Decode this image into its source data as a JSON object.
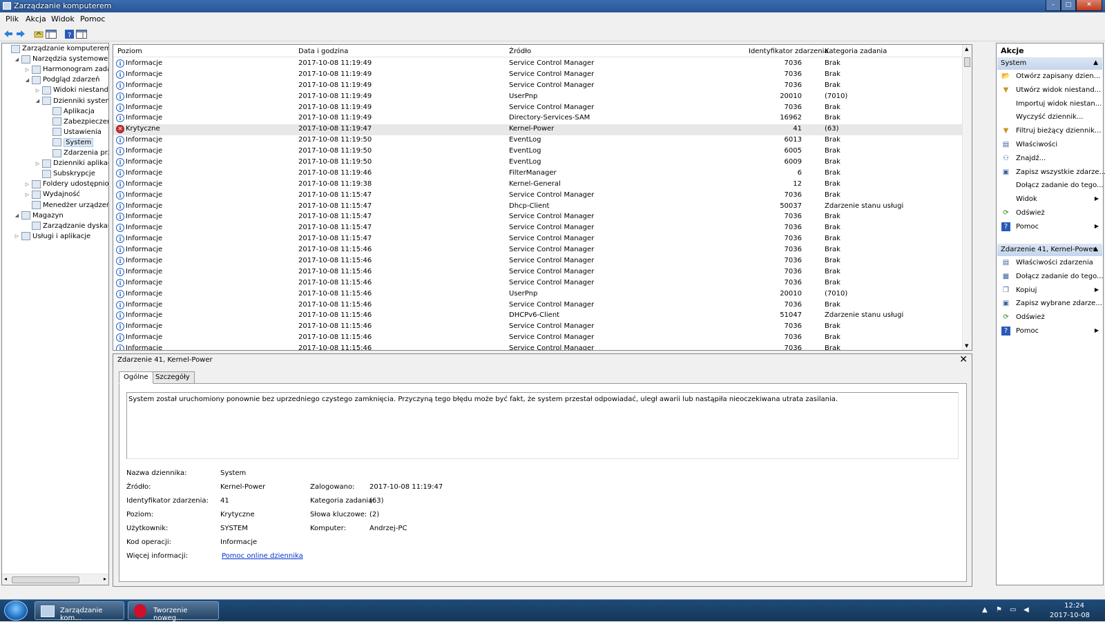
{
  "window": {
    "title": "Zarządzanie komputerem",
    "min": "–",
    "max": "□",
    "close": "✕"
  },
  "menu": [
    "Plik",
    "Akcja",
    "Widok",
    "Pomoc"
  ],
  "tree": [
    {
      "label": "Zarządzanie komputerem (loka",
      "depth": 0,
      "exp": ""
    },
    {
      "label": "Narzędzia systemowe",
      "depth": 1,
      "exp": "◢"
    },
    {
      "label": "Harmonogram zadań",
      "depth": 2,
      "exp": "▷"
    },
    {
      "label": "Podgląd zdarzeń",
      "depth": 2,
      "exp": "◢"
    },
    {
      "label": "Widoki niestandardo",
      "depth": 3,
      "exp": "▷"
    },
    {
      "label": "Dzienniki systemu W",
      "depth": 3,
      "exp": "◢"
    },
    {
      "label": "Aplikacja",
      "depth": 4,
      "exp": ""
    },
    {
      "label": "Zabezpieczenia",
      "depth": 4,
      "exp": ""
    },
    {
      "label": "Ustawienia",
      "depth": 4,
      "exp": ""
    },
    {
      "label": "System",
      "depth": 4,
      "exp": "",
      "selected": true
    },
    {
      "label": "Zdarzenia przesy",
      "depth": 4,
      "exp": ""
    },
    {
      "label": "Dzienniki aplikacji i u",
      "depth": 3,
      "exp": "▷"
    },
    {
      "label": "Subskrypcje",
      "depth": 3,
      "exp": ""
    },
    {
      "label": "Foldery udostępnione",
      "depth": 2,
      "exp": "▷"
    },
    {
      "label": "Wydajność",
      "depth": 2,
      "exp": "▷"
    },
    {
      "label": "Menedżer urządzeń",
      "depth": 2,
      "exp": ""
    },
    {
      "label": "Magazyn",
      "depth": 1,
      "exp": "◢"
    },
    {
      "label": "Zarządzanie dyskami",
      "depth": 2,
      "exp": ""
    },
    {
      "label": "Usługi i aplikacje",
      "depth": 1,
      "exp": "▷"
    }
  ],
  "grid": {
    "columns": [
      "Poziom",
      "Data i godzina",
      "Źródło",
      "Identyfikator zdarzenia",
      "Kategoria zadania"
    ],
    "rows": [
      {
        "level": "Informacje",
        "date": "2017-10-08 11:19:49",
        "source": "Service Control Manager",
        "id": "7036",
        "cat": "Brak"
      },
      {
        "level": "Informacje",
        "date": "2017-10-08 11:19:49",
        "source": "Service Control Manager",
        "id": "7036",
        "cat": "Brak"
      },
      {
        "level": "Informacje",
        "date": "2017-10-08 11:19:49",
        "source": "Service Control Manager",
        "id": "7036",
        "cat": "Brak"
      },
      {
        "level": "Informacje",
        "date": "2017-10-08 11:19:49",
        "source": "UserPnp",
        "id": "20010",
        "cat": "(7010)"
      },
      {
        "level": "Informacje",
        "date": "2017-10-08 11:19:49",
        "source": "Service Control Manager",
        "id": "7036",
        "cat": "Brak"
      },
      {
        "level": "Informacje",
        "date": "2017-10-08 11:19:49",
        "source": "Directory-Services-SAM",
        "id": "16962",
        "cat": "Brak"
      },
      {
        "level": "Krytyczne",
        "date": "2017-10-08 11:19:47",
        "source": "Kernel-Power",
        "id": "41",
        "cat": "(63)",
        "critical": true
      },
      {
        "level": "Informacje",
        "date": "2017-10-08 11:19:50",
        "source": "EventLog",
        "id": "6013",
        "cat": "Brak"
      },
      {
        "level": "Informacje",
        "date": "2017-10-08 11:19:50",
        "source": "EventLog",
        "id": "6005",
        "cat": "Brak"
      },
      {
        "level": "Informacje",
        "date": "2017-10-08 11:19:50",
        "source": "EventLog",
        "id": "6009",
        "cat": "Brak"
      },
      {
        "level": "Informacje",
        "date": "2017-10-08 11:19:46",
        "source": "FilterManager",
        "id": "6",
        "cat": "Brak"
      },
      {
        "level": "Informacje",
        "date": "2017-10-08 11:19:38",
        "source": "Kernel-General",
        "id": "12",
        "cat": "Brak"
      },
      {
        "level": "Informacje",
        "date": "2017-10-08 11:15:47",
        "source": "Service Control Manager",
        "id": "7036",
        "cat": "Brak"
      },
      {
        "level": "Informacje",
        "date": "2017-10-08 11:15:47",
        "source": "Dhcp-Client",
        "id": "50037",
        "cat": "Zdarzenie stanu usługi"
      },
      {
        "level": "Informacje",
        "date": "2017-10-08 11:15:47",
        "source": "Service Control Manager",
        "id": "7036",
        "cat": "Brak"
      },
      {
        "level": "Informacje",
        "date": "2017-10-08 11:15:47",
        "source": "Service Control Manager",
        "id": "7036",
        "cat": "Brak"
      },
      {
        "level": "Informacje",
        "date": "2017-10-08 11:15:47",
        "source": "Service Control Manager",
        "id": "7036",
        "cat": "Brak"
      },
      {
        "level": "Informacje",
        "date": "2017-10-08 11:15:46",
        "source": "Service Control Manager",
        "id": "7036",
        "cat": "Brak"
      },
      {
        "level": "Informacje",
        "date": "2017-10-08 11:15:46",
        "source": "Service Control Manager",
        "id": "7036",
        "cat": "Brak"
      },
      {
        "level": "Informacje",
        "date": "2017-10-08 11:15:46",
        "source": "Service Control Manager",
        "id": "7036",
        "cat": "Brak"
      },
      {
        "level": "Informacje",
        "date": "2017-10-08 11:15:46",
        "source": "Service Control Manager",
        "id": "7036",
        "cat": "Brak"
      },
      {
        "level": "Informacje",
        "date": "2017-10-08 11:15:46",
        "source": "UserPnp",
        "id": "20010",
        "cat": "(7010)"
      },
      {
        "level": "Informacje",
        "date": "2017-10-08 11:15:46",
        "source": "Service Control Manager",
        "id": "7036",
        "cat": "Brak"
      },
      {
        "level": "Informacje",
        "date": "2017-10-08 11:15:46",
        "source": "DHCPv6-Client",
        "id": "51047",
        "cat": "Zdarzenie stanu usługi"
      },
      {
        "level": "Informacje",
        "date": "2017-10-08 11:15:46",
        "source": "Service Control Manager",
        "id": "7036",
        "cat": "Brak"
      },
      {
        "level": "Informacje",
        "date": "2017-10-08 11:15:46",
        "source": "Service Control Manager",
        "id": "7036",
        "cat": "Brak"
      },
      {
        "level": "Informacje",
        "date": "2017-10-08 11:15:46",
        "source": "Service Control Manager",
        "id": "7036",
        "cat": "Brak"
      }
    ]
  },
  "detail": {
    "title": "Zdarzenie 41, Kernel-Power",
    "close": "✕",
    "tabs": [
      "Ogólne",
      "Szczegóły"
    ],
    "description": "System został uruchomiony ponownie bez uprzedniego czystego zamknięcia. Przyczyną tego błędu może być fakt, że system przestał odpowiadać, uległ awarii lub nastąpiła nieoczekiwana utrata zasilania.",
    "fields": {
      "log_name_label": "Nazwa dziennika:",
      "log_name": "System",
      "source_label": "Źródło:",
      "source": "Kernel-Power",
      "logged_label": "Zalogowano:",
      "logged": "2017-10-08 11:19:47",
      "event_id_label": "Identyfikator zdarzenia:",
      "event_id": "41",
      "task_cat_label": "Kategoria zadania:",
      "task_cat": "(63)",
      "level_label": "Poziom:",
      "level": "Krytyczne",
      "keywords_label": "Słowa kluczowe:",
      "keywords": "(2)",
      "user_label": "Użytkownik:",
      "user": "SYSTEM",
      "computer_label": "Komputer:",
      "computer": "Andrzej-PC",
      "opcode_label": "Kod operacji:",
      "opcode": "Informacje",
      "more_info_label": "Więcej informacji:",
      "more_info_link": "Pomoc online dziennika"
    }
  },
  "actions": {
    "title": "Akcje",
    "section1": "System",
    "section1_items": [
      {
        "label": "Otwórz zapisany dzien...",
        "icon": "open-folder-icon",
        "glyph": "📂",
        "sub": false
      },
      {
        "label": "Utwórz widok niestand...",
        "icon": "filter-icon",
        "glyph": "▼",
        "sub": false
      },
      {
        "label": "Importuj widok niestan...",
        "icon": "",
        "glyph": "",
        "sub": false
      },
      {
        "label": "Wyczyść dziennik...",
        "icon": "",
        "glyph": "",
        "sub": false
      },
      {
        "label": "Filtruj bieżący dziennik...",
        "icon": "filter-icon",
        "glyph": "▼",
        "sub": false
      },
      {
        "label": "Właściwości",
        "icon": "properties-icon",
        "glyph": "▤",
        "sub": false
      },
      {
        "label": "Znajdź...",
        "icon": "binoculars-icon",
        "glyph": "⚇",
        "sub": false
      },
      {
        "label": "Zapisz wszystkie zdarze...",
        "icon": "save-icon",
        "glyph": "▣",
        "sub": false
      },
      {
        "label": "Dołącz zadanie do tego...",
        "icon": "",
        "glyph": "",
        "sub": false
      },
      {
        "label": "Widok",
        "icon": "",
        "glyph": "",
        "sub": true
      },
      {
        "label": "Odśwież",
        "icon": "refresh-icon",
        "glyph": "⟳",
        "sub": false
      },
      {
        "label": "Pomoc",
        "icon": "help-icon",
        "glyph": "?",
        "sub": true
      }
    ],
    "section2": "Zdarzenie 41, Kernel-Power",
    "section2_items": [
      {
        "label": "Właściwości zdarzenia",
        "icon": "properties-icon",
        "glyph": "▤",
        "sub": false
      },
      {
        "label": "Dołącz zadanie do tego...",
        "icon": "task-icon",
        "glyph": "▦",
        "sub": false
      },
      {
        "label": "Kopiuj",
        "icon": "copy-icon",
        "glyph": "❐",
        "sub": true
      },
      {
        "label": "Zapisz wybrane zdarze...",
        "icon": "save-icon",
        "glyph": "▣",
        "sub": false
      },
      {
        "label": "Odśwież",
        "icon": "refresh-icon",
        "glyph": "⟳",
        "sub": false
      },
      {
        "label": "Pomoc",
        "icon": "help-icon",
        "glyph": "?",
        "sub": true
      }
    ]
  },
  "taskbar": {
    "tasks": [
      "Zarządzanie kom...",
      "Tworzenie noweg..."
    ],
    "time": "12:24",
    "date": "2017-10-08"
  },
  "colors": {
    "accent": "#2b63c3",
    "critical": "#cc3333",
    "link": "#0033cc"
  }
}
